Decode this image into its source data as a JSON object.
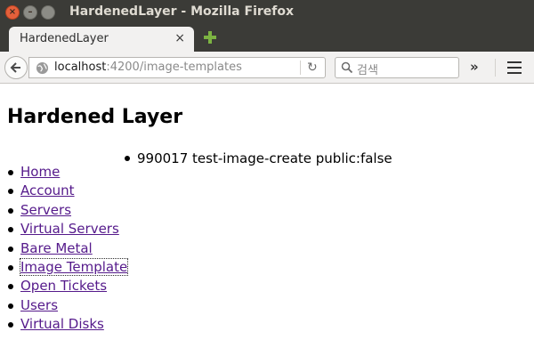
{
  "window": {
    "title": "HardenedLayer - Mozilla Firefox"
  },
  "tab": {
    "label": "HardenedLayer",
    "close_glyph": "×"
  },
  "urlbar": {
    "host": "localhost",
    "path": ":4200/image-templates"
  },
  "searchbar": {
    "placeholder": "검색"
  },
  "toolbar": {
    "overflow_glyph": "»",
    "reload_glyph": "↻"
  },
  "page": {
    "title": "Hardened Layer",
    "nav_links": [
      {
        "label": "Home"
      },
      {
        "label": "Account"
      },
      {
        "label": "Servers"
      },
      {
        "label": "Virtual Servers"
      },
      {
        "label": "Bare Metal"
      },
      {
        "label": "Image Template"
      },
      {
        "label": "Open Tickets"
      },
      {
        "label": "Users"
      },
      {
        "label": "Virtual Disks"
      }
    ],
    "templates": [
      {
        "text": "990017 test-image-create public:false"
      }
    ]
  },
  "colors": {
    "titlebar": "#3b3b37",
    "close_button": "#e4603b",
    "link_visited": "#551a8b",
    "newtab_plus": "#7cb342"
  }
}
